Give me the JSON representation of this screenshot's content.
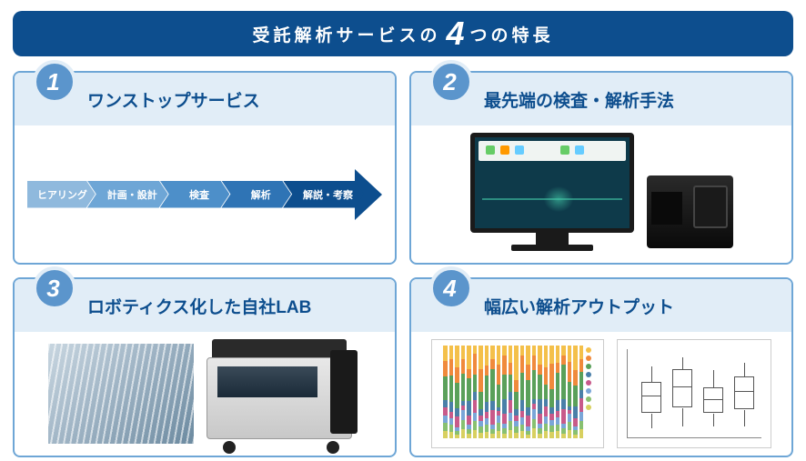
{
  "header": {
    "prefix": "受託解析サービスの",
    "number": "4",
    "suffix": "つの特長"
  },
  "cards": [
    {
      "num": "1",
      "title": "ワンストップサービス"
    },
    {
      "num": "2",
      "title": "最先端の検査・解析手法"
    },
    {
      "num": "3",
      "title": "ロボティクス化した自社LAB"
    },
    {
      "num": "4",
      "title": "幅広い解析アウトプット"
    }
  ],
  "flow_steps": [
    {
      "label": "ヒアリング",
      "color": "#8fb9dd"
    },
    {
      "label": "計画・設計",
      "color": "#6ea6d6"
    },
    {
      "label": "検査",
      "color": "#4d8fc9"
    },
    {
      "label": "解析",
      "color": "#2f74b5"
    },
    {
      "label": "解説・考察",
      "color": "#0d4e8e"
    }
  ],
  "chart_data": {
    "stacked_bar": {
      "type": "bar",
      "note": "stacked composition chart (values illustrative, unlabeled in source)",
      "segment_colors": [
        "#f4c04a",
        "#f08a3c",
        "#5aa05a",
        "#4a7fa8",
        "#c85a8a",
        "#7aa6d8",
        "#88c070",
        "#d8d060"
      ]
    },
    "boxplot": {
      "type": "boxplot",
      "groups": 4
    }
  }
}
